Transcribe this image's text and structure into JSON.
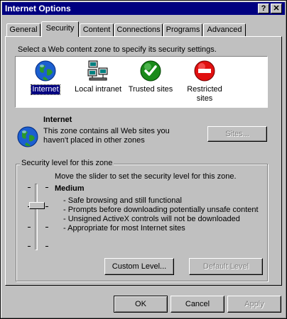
{
  "window": {
    "title": "Internet Options",
    "help_btn": "?",
    "close_btn": "✕"
  },
  "tabs": [
    {
      "label": "General"
    },
    {
      "label": "Security"
    },
    {
      "label": "Content"
    },
    {
      "label": "Connections"
    },
    {
      "label": "Programs"
    },
    {
      "label": "Advanced"
    }
  ],
  "security": {
    "instructions": "Select a Web content zone to specify its security settings.",
    "zones": [
      {
        "label": "Internet",
        "icon": "globe-icon",
        "selected": true
      },
      {
        "label": "Local intranet",
        "icon": "network-computers-icon",
        "selected": false
      },
      {
        "label": "Trusted sites",
        "icon": "check-circle-icon",
        "selected": false
      },
      {
        "label": "Restricted sites",
        "icon": "no-entry-icon",
        "selected": false
      }
    ],
    "zone_info": {
      "name": "Internet",
      "desc_line1": "This zone contains all Web sites you",
      "desc_line2": "haven't placed in other zones",
      "sites_button": "Sites..."
    },
    "level": {
      "group_title": "Security level for this zone",
      "hint": "Move the slider to set the security level for this zone.",
      "current": "Medium",
      "bullets": [
        "- Safe browsing and still functional",
        "- Prompts before downloading potentially unsafe content",
        "- Unsigned ActiveX controls will not be downloaded",
        "- Appropriate for most Internet sites"
      ],
      "custom_button": "Custom Level...",
      "default_button": "Default Level"
    }
  },
  "footer": {
    "ok": "OK",
    "cancel": "Cancel",
    "apply": "Apply"
  },
  "colors": {
    "titlebar": "#000080",
    "face": "#c0c0c0",
    "selection": "#000080"
  }
}
